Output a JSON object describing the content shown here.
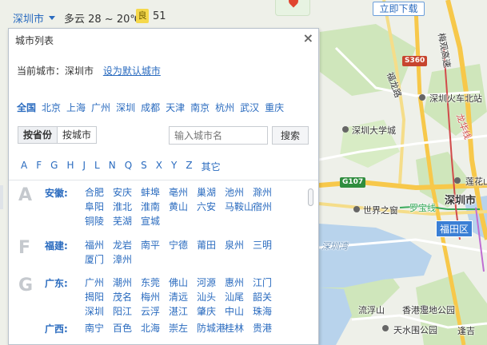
{
  "topbar": {
    "city": "深圳市",
    "weather": "多云 28 ~ 20℃",
    "aqi_level": "良",
    "aqi_value": "51"
  },
  "promo": {
    "download_label": "立即下载"
  },
  "panel": {
    "title": "城市列表",
    "close_label": "×",
    "current_city_label": "当前城市：深圳市",
    "set_default_label": "设为默认城市",
    "hot_cities": [
      "全国",
      "北京",
      "上海",
      "广州",
      "深圳",
      "成都",
      "天津",
      "南京",
      "杭州",
      "武汉",
      "重庆"
    ],
    "tabs": [
      "按省份",
      "按城市"
    ],
    "search_placeholder": "输入城市名",
    "search_button": "搜索",
    "letters": [
      "A",
      "F",
      "G",
      "H",
      "J",
      "L",
      "N",
      "Q",
      "S",
      "X",
      "Y",
      "Z",
      "其它"
    ],
    "groups": [
      {
        "letter": "A",
        "provinces": [
          {
            "name": "安徽:",
            "cities": [
              "合肥",
              "安庆",
              "蚌埠",
              "亳州",
              "巢湖",
              "池州",
              "滁州",
              "阜阳",
              "淮北",
              "淮南",
              "黄山",
              "六安",
              "马鞍山",
              "宿州",
              "铜陵",
              "芜湖",
              "宣城"
            ]
          }
        ]
      },
      {
        "letter": "F",
        "provinces": [
          {
            "name": "福建:",
            "cities": [
              "福州",
              "龙岩",
              "南平",
              "宁德",
              "莆田",
              "泉州",
              "三明",
              "厦门",
              "漳州"
            ]
          }
        ]
      },
      {
        "letter": "G",
        "provinces": [
          {
            "name": "广东:",
            "cities": [
              "广州",
              "潮州",
              "东莞",
              "佛山",
              "河源",
              "惠州",
              "江门",
              "揭阳",
              "茂名",
              "梅州",
              "清远",
              "汕头",
              "汕尾",
              "韶关",
              "深圳",
              "阳江",
              "云浮",
              "湛江",
              "肇庆",
              "中山",
              "珠海"
            ]
          },
          {
            "name": "广西:",
            "cities": [
              "南宁",
              "百色",
              "北海",
              "崇左",
              "防城港",
              "桂林",
              "贵港"
            ]
          }
        ]
      }
    ]
  },
  "map": {
    "labels": [
      "深圳火车北站",
      "深圳大学城",
      "世界之窗",
      "深圳市",
      "福田区",
      "深圳湾",
      "流浮山",
      "香港湿地公园",
      "天水围公园",
      "莲花山",
      "罗宝线",
      "梅观高速",
      "福龙路",
      "龙华线",
      "逢吉"
    ],
    "shields": [
      "S360",
      "G107"
    ],
    "colors": {
      "land": "#eef0e9",
      "water": "#b8d3ec",
      "green": "#c9e4b4",
      "road_major": "#f7c84a",
      "road_minor": "#ffffff",
      "accent": "#2a6bbf"
    }
  }
}
